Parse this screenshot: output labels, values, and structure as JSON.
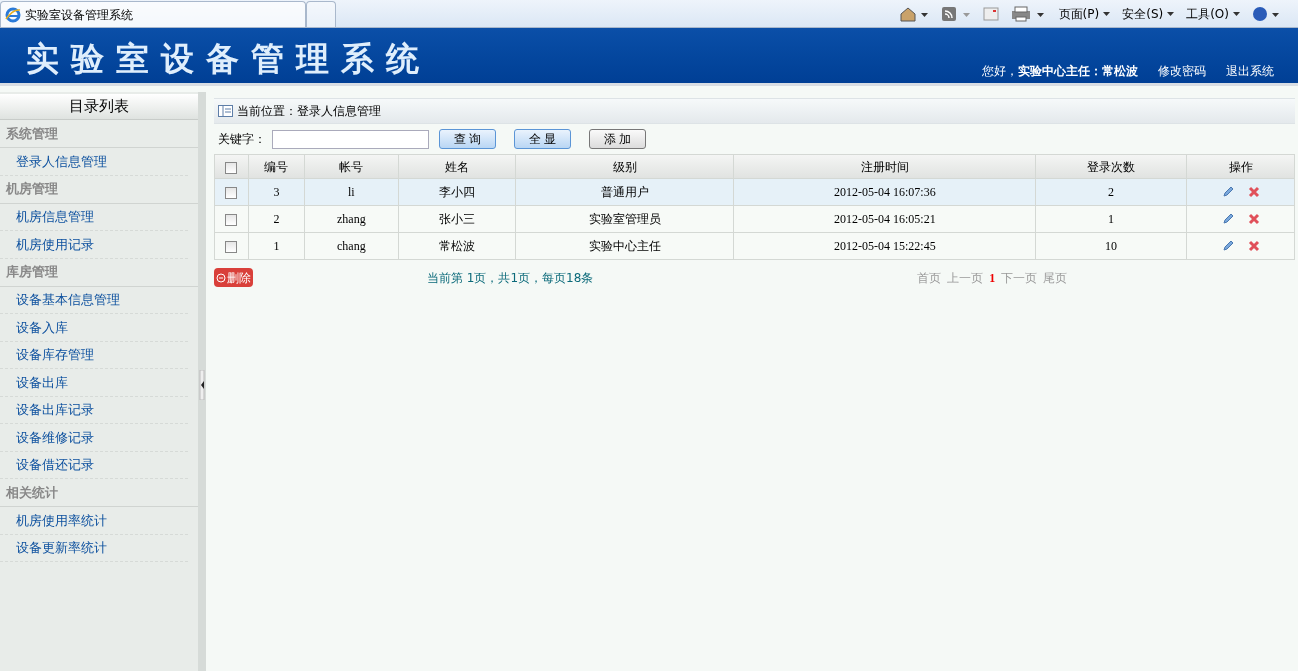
{
  "browser": {
    "tab_title": "实验室设备管理系统",
    "menus": [
      "页面(P)",
      "安全(S)",
      "工具(O)"
    ]
  },
  "header": {
    "title": "实验室设备管理系统",
    "greeting": "您好，",
    "user": "实验中心主任：常松波",
    "links": [
      "修改密码",
      "退出系统"
    ]
  },
  "sidebar": {
    "title": "目录列表",
    "sections": [
      {
        "label": "系统管理",
        "items": [
          "登录人信息管理"
        ]
      },
      {
        "label": "机房管理",
        "items": [
          "机房信息管理",
          "机房使用记录"
        ]
      },
      {
        "label": "库房管理",
        "items": [
          "设备基本信息管理",
          "设备入库",
          "设备库存管理",
          "设备出库",
          "设备出库记录",
          "设备维修记录",
          "设备借还记录"
        ]
      },
      {
        "label": "相关统计",
        "items": [
          "机房使用率统计",
          "设备更新率统计"
        ]
      }
    ]
  },
  "breadcrumb": "当前位置：登录人信息管理",
  "search": {
    "label": "关键字：",
    "buttons": [
      "查 询",
      "全 显",
      "添 加"
    ]
  },
  "table": {
    "columns": [
      "编号",
      "帐号",
      "姓名",
      "级别",
      "注册时间",
      "登录次数",
      "操作"
    ],
    "header_checked": false,
    "rows": [
      {
        "cells": [
          "3",
          "li",
          "李小四",
          "普通用户",
          "2012-05-04 16:07:36",
          "2"
        ],
        "selected": true,
        "checked": false
      },
      {
        "cells": [
          "2",
          "zhang",
          "张小三",
          "实验室管理员",
          "2012-05-04 16:05:21",
          "1"
        ],
        "selected": false,
        "checked": false
      },
      {
        "cells": [
          "1",
          "chang",
          "常松波",
          "实验中心主任",
          "2012-05-04 15:22:45",
          "10"
        ],
        "selected": false,
        "checked": false
      }
    ]
  },
  "delete_button": "删除",
  "page_info": "当前第 1页，共1页，每页18条",
  "pager": [
    {
      "label": "首页",
      "current": false
    },
    {
      "label": "上一页",
      "current": false
    },
    {
      "label": "1",
      "current": true
    },
    {
      "label": "下一页",
      "current": false
    },
    {
      "label": "尾页",
      "current": false
    }
  ]
}
